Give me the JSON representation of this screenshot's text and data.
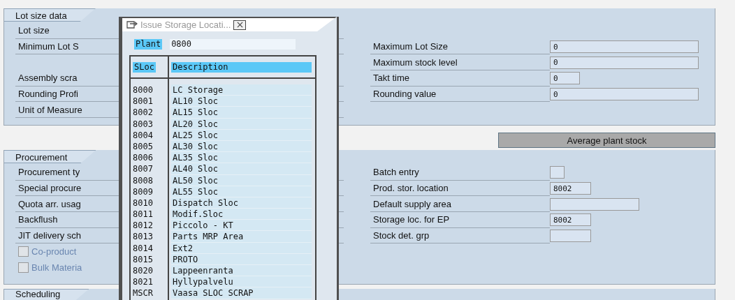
{
  "sections": [
    {
      "title": "Lot size data",
      "left": [
        {
          "kind": "label",
          "label": "Lot size"
        },
        {
          "kind": "label",
          "label": "Minimum Lot S"
        },
        {
          "kind": "blank"
        },
        {
          "kind": "label",
          "label": "Assembly scra"
        },
        {
          "kind": "label",
          "label": "Rounding Profi"
        },
        {
          "kind": "label",
          "label": "Unit of Measure"
        }
      ],
      "right": [
        {
          "kind": "blank"
        },
        {
          "kind": "field_wide",
          "label": "Maximum Lot Size",
          "value": "0"
        },
        {
          "kind": "field_wide",
          "label": "Maximum stock level",
          "value": "0"
        },
        {
          "kind": "field_tiny",
          "label": "Takt time",
          "value": "0"
        },
        {
          "kind": "field_wide",
          "label": "Rounding value",
          "value": "0"
        }
      ],
      "button": "Average plant stock"
    },
    {
      "title": "Procurement",
      "left": [
        {
          "kind": "label",
          "label": "Procurement ty"
        },
        {
          "kind": "label",
          "label": "Special procure"
        },
        {
          "kind": "label",
          "label": "Quota arr. usag"
        },
        {
          "kind": "label",
          "label": "Backflush"
        },
        {
          "kind": "label",
          "label": "JIT delivery sch"
        },
        {
          "kind": "checkbox",
          "label": "Co-product",
          "checked": false,
          "disabled": true
        },
        {
          "kind": "checkbox",
          "label": "Bulk Materia",
          "checked": false,
          "disabled": true
        }
      ],
      "right": [
        {
          "kind": "check_field",
          "label": "Batch entry",
          "checked": false
        },
        {
          "kind": "field_short",
          "label": "Prod. stor. location",
          "value": "8002"
        },
        {
          "kind": "field_medium",
          "label": "Default supply area"
        },
        {
          "kind": "field_short",
          "label": "Storage loc. for EP",
          "value": "8002"
        },
        {
          "kind": "field_short",
          "label": "Stock det. grp"
        }
      ]
    },
    {
      "title": "Scheduling"
    }
  ],
  "popup": {
    "title": "Issue Storage Locati...",
    "plant_label": "Plant",
    "plant_value": "0800",
    "columns": [
      "SLoc",
      "Description"
    ],
    "rows": [
      {
        "sloc": "8000",
        "description": "LC Storage"
      },
      {
        "sloc": "8001",
        "description": "AL10 Sloc"
      },
      {
        "sloc": "8002",
        "description": "AL15 Sloc"
      },
      {
        "sloc": "8003",
        "description": "AL20 Sloc"
      },
      {
        "sloc": "8004",
        "description": "AL25 Sloc"
      },
      {
        "sloc": "8005",
        "description": "AL30 Sloc"
      },
      {
        "sloc": "8006",
        "description": "AL35 Sloc"
      },
      {
        "sloc": "8007",
        "description": "AL40 Sloc"
      },
      {
        "sloc": "8008",
        "description": "AL50 Sloc"
      },
      {
        "sloc": "8009",
        "description": "AL55 Sloc"
      },
      {
        "sloc": "8010",
        "description": "Dispatch Sloc"
      },
      {
        "sloc": "8011",
        "description": "Modif.Sloc"
      },
      {
        "sloc": "8012",
        "description": "Piccolo - KT"
      },
      {
        "sloc": "8013",
        "description": "Parts MRP Area"
      },
      {
        "sloc": "8014",
        "description": "Ext2"
      },
      {
        "sloc": "8015",
        "description": "PROTO"
      },
      {
        "sloc": "8020",
        "description": "Lappeenranta"
      },
      {
        "sloc": "8021",
        "description": "Hyllypalvelu"
      },
      {
        "sloc": "MSCR",
        "description": "Vaasa SLOC SCRAP"
      }
    ]
  }
}
